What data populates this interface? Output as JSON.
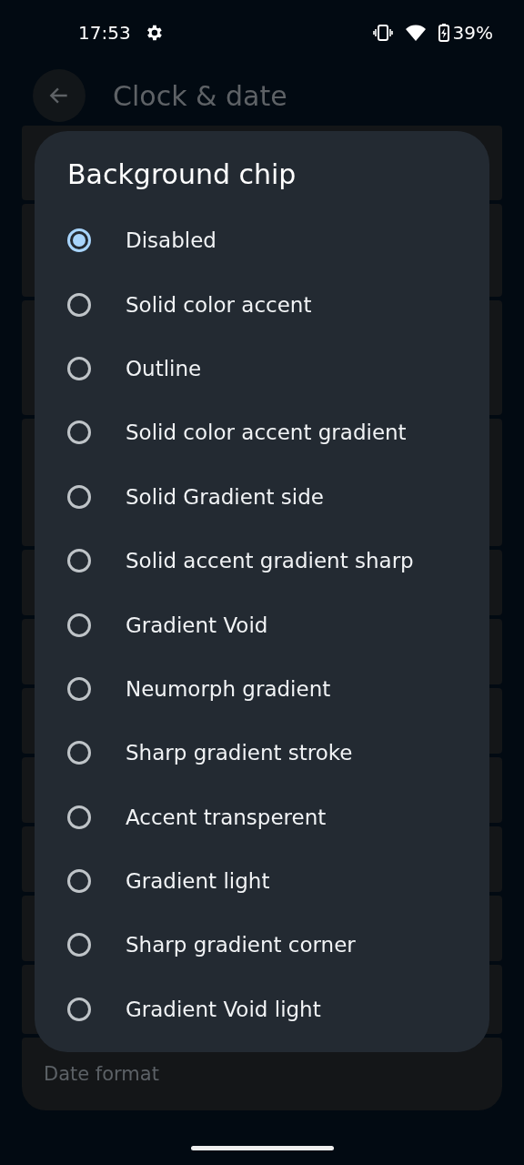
{
  "status_bar": {
    "time": "17:53",
    "battery": "39%"
  },
  "top_bar": {
    "title": "Clock & date"
  },
  "background_list": {
    "last_item": "Date format"
  },
  "dialog": {
    "title": "Background chip",
    "options": [
      {
        "label": "Disabled",
        "selected": true
      },
      {
        "label": "Solid color accent",
        "selected": false
      },
      {
        "label": "Outline",
        "selected": false
      },
      {
        "label": "Solid color accent gradient",
        "selected": false
      },
      {
        "label": "Solid Gradient side",
        "selected": false
      },
      {
        "label": "Solid accent gradient sharp",
        "selected": false
      },
      {
        "label": "Gradient Void",
        "selected": false
      },
      {
        "label": "Neumorph gradient",
        "selected": false
      },
      {
        "label": "Sharp gradient stroke",
        "selected": false
      },
      {
        "label": "Accent transperent",
        "selected": false
      },
      {
        "label": "Gradient light",
        "selected": false
      },
      {
        "label": "Sharp gradient corner",
        "selected": false
      },
      {
        "label": "Gradient Void light",
        "selected": false
      }
    ]
  }
}
